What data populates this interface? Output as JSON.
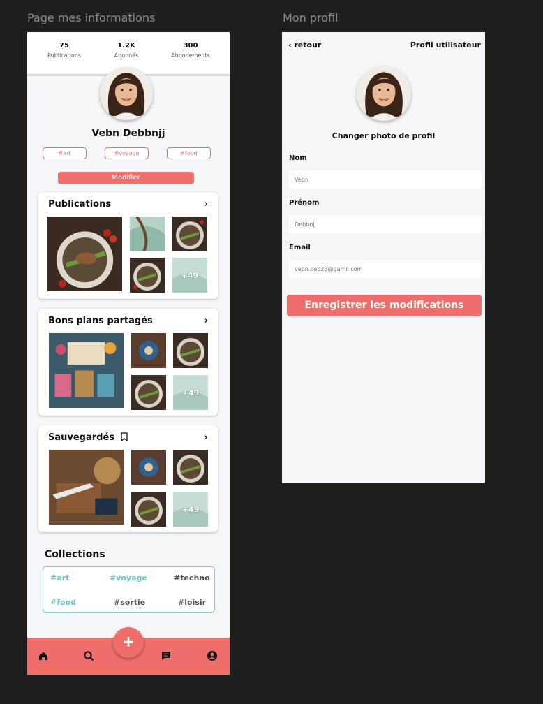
{
  "frames": {
    "profile_page_label": "Page mes informations",
    "edit_page_label": "Mon profil"
  },
  "stats": [
    {
      "value": "75",
      "label": "Publications"
    },
    {
      "value": "1.2K",
      "label": "Abonnés"
    },
    {
      "value": "300",
      "label": "Abonnements"
    }
  ],
  "user": {
    "name": "Vebn Debbnjj"
  },
  "tags": [
    "#art",
    "#voyage",
    "#food"
  ],
  "modify_label": "Modifier",
  "sections": {
    "publications": {
      "title": "Publications",
      "more": "+49"
    },
    "bons_plans": {
      "title": "Bons plans partagés",
      "more": "+49"
    },
    "sauvegardes": {
      "title": "Sauvegardés",
      "more": "+49"
    }
  },
  "chevron": "›",
  "collections": {
    "title": "Collections",
    "items": [
      {
        "label": "#art",
        "color": "#6cc6c6"
      },
      {
        "label": "#voyage",
        "color": "#6cc6c6"
      },
      {
        "label": "#techno",
        "color": "#555555"
      },
      {
        "label": "#food",
        "color": "#6cc6c6"
      },
      {
        "label": "#sortie",
        "color": "#555555"
      },
      {
        "label": "#loisir",
        "color": "#555555"
      }
    ]
  },
  "fab_label": "+",
  "nav": [
    "home-icon",
    "search-icon",
    "chat-icon",
    "account-icon"
  ],
  "edit": {
    "back_label": "‹ retour",
    "title": "Profil utilisateur",
    "change_photo": "Changer photo de profil",
    "fields": [
      {
        "label": "Nom",
        "value": "Vebn"
      },
      {
        "label": "Prénom",
        "value": "Debbnjj"
      },
      {
        "label": "Email",
        "value": "vebn.deb23@gamil.com"
      }
    ],
    "save_label": "Enregistrer les modifications"
  },
  "colors": {
    "accent": "#ef6e6b",
    "teal": "#6cc6c6"
  }
}
